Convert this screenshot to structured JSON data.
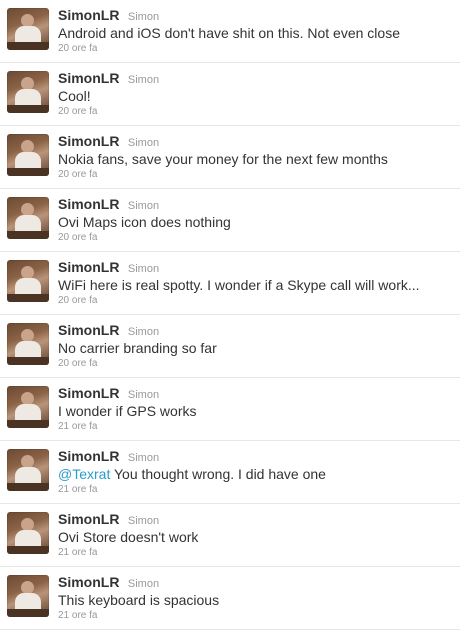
{
  "tweets": [
    {
      "screen_name": "SimonLR",
      "full_name": "Simon",
      "text": "Android and iOS don't have shit on this. Not even close",
      "time": "20 ore fa"
    },
    {
      "screen_name": "SimonLR",
      "full_name": "Simon",
      "text": "Cool!",
      "time": "20 ore fa"
    },
    {
      "screen_name": "SimonLR",
      "full_name": "Simon",
      "text": "Nokia fans, save your money for the next few months",
      "time": "20 ore fa"
    },
    {
      "screen_name": "SimonLR",
      "full_name": "Simon",
      "text": "Ovi Maps icon does nothing",
      "time": "20 ore fa"
    },
    {
      "screen_name": "SimonLR",
      "full_name": "Simon",
      "text": "WiFi here is real spotty. I wonder if a Skype call will work...",
      "time": "20 ore fa"
    },
    {
      "screen_name": "SimonLR",
      "full_name": "Simon",
      "text": "No carrier branding so far",
      "time": "20 ore fa"
    },
    {
      "screen_name": "SimonLR",
      "full_name": "Simon",
      "text": "I wonder if GPS works",
      "time": "21 ore fa"
    },
    {
      "screen_name": "SimonLR",
      "full_name": "Simon",
      "mention": "@Texrat",
      "text": " You thought wrong. I did have one",
      "time": "21 ore fa"
    },
    {
      "screen_name": "SimonLR",
      "full_name": "Simon",
      "text": "Ovi Store doesn't work",
      "time": "21 ore fa"
    },
    {
      "screen_name": "SimonLR",
      "full_name": "Simon",
      "text": "This keyboard is spacious",
      "time": "21 ore fa"
    }
  ],
  "colors": {
    "mention": "#2b9cc9",
    "meta_gray": "#999999",
    "text": "#333333",
    "divider": "#e6e6e6"
  }
}
